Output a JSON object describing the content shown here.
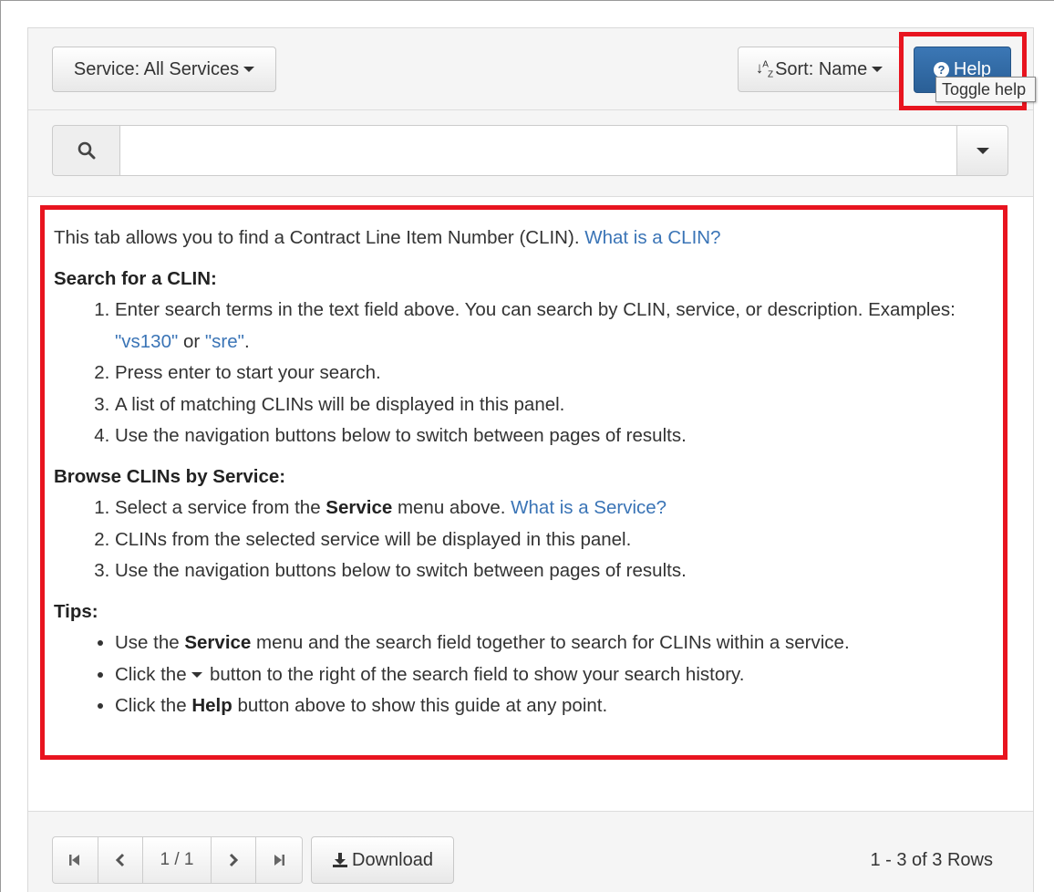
{
  "toolbar": {
    "service_label": "Service: All Services",
    "sort_label": "Sort: Name",
    "help_label": "Help",
    "tooltip": "Toggle help"
  },
  "search": {
    "value": "",
    "placeholder": ""
  },
  "help": {
    "intro": "This tab allows you to find a Contract Line Item Number (CLIN).",
    "intro_link": "What is a CLIN?",
    "search_heading": "Search for a CLIN:",
    "search_step1_a": "Enter search terms in the text field above. You can search by CLIN, service, or description. Examples: ",
    "search_example1": "\"vs130\"",
    "search_or": " or ",
    "search_example2": "\"sre\"",
    "search_period": ".",
    "search_step2": "Press enter to start your search.",
    "search_step3": "A list of matching CLINs will be displayed in this panel.",
    "search_step4": "Use the navigation buttons below to switch between pages of results.",
    "browse_heading": "Browse CLINs by Service:",
    "browse_step1_a": "Select a service from the ",
    "browse_step1_bold": "Service",
    "browse_step1_b": " menu above. ",
    "browse_step1_link": "What is a Service?",
    "browse_step2": "CLINs from the selected service will be displayed in this panel.",
    "browse_step3": "Use the navigation buttons below to switch between pages of results.",
    "tips_heading": "Tips:",
    "tip1_a": "Use the ",
    "tip1_bold": "Service",
    "tip1_b": " menu and the search field together to search for CLINs within a service.",
    "tip2_a": "Click the ",
    "tip2_b": " button to the right of the search field to show your search history.",
    "tip3_a": "Click the ",
    "tip3_bold": "Help",
    "tip3_b": " button above to show this guide at any point."
  },
  "footer": {
    "page_indicator": "1 / 1",
    "download_label": "Download",
    "rows_count": "1 - 3 of 3 Rows"
  },
  "colors": {
    "highlight": "#e8141f",
    "primary": "#2a5f96",
    "link": "#3a74b6"
  },
  "icons": {
    "search": "search-icon",
    "sort": "sort-alpha-icon",
    "help": "question-circle-icon",
    "download": "download-icon",
    "first": "first-page-icon",
    "prev": "chevron-left-icon",
    "next": "chevron-right-icon",
    "last": "last-page-icon"
  }
}
